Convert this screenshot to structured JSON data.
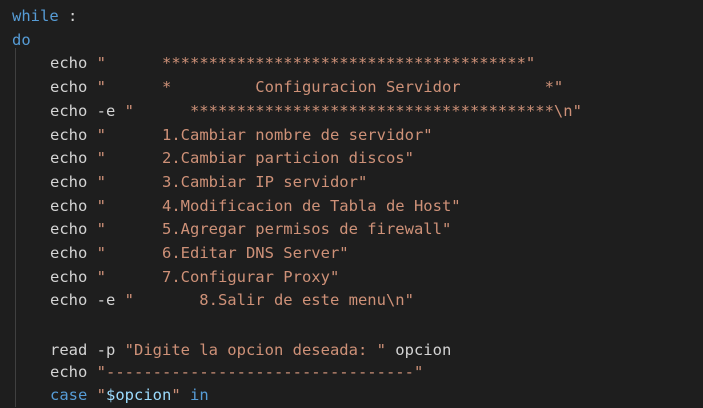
{
  "editor": {
    "lines": [
      {
        "kw": "while",
        "rest": " :"
      },
      {
        "kw": "do"
      },
      {
        "cmd": "echo",
        "str": "\"      ***************************************\""
      },
      {
        "cmd": "echo",
        "str": "\"      *         Configuracion Servidor         *\""
      },
      {
        "cmd": "echo",
        "flag": " -e ",
        "str": "\"      ***************************************\\n\""
      },
      {
        "cmd": "echo",
        "str": "\"      1.Cambiar nombre de servidor\""
      },
      {
        "cmd": "echo",
        "str": "\"      2.Cambiar particion discos\""
      },
      {
        "cmd": "echo",
        "str": "\"      3.Cambiar IP servidor\""
      },
      {
        "cmd": "echo",
        "str": "\"      4.Modificacion de Tabla de Host\""
      },
      {
        "cmd": "echo",
        "str": "\"      5.Agregar permisos de firewall\""
      },
      {
        "cmd": "echo",
        "str": "\"      6.Editar DNS Server\""
      },
      {
        "cmd": "echo",
        "str": "\"      7.Configurar Proxy\""
      },
      {
        "cmd": "echo",
        "flag": " -e ",
        "str": "\"       8.Salir de este menu\\n\""
      },
      {
        "empty": true
      },
      {
        "cmd": "read",
        "flag": " -p ",
        "str": "\"Digite la opcion deseada: \"",
        "rest": " opcion"
      },
      {
        "cmd": "echo",
        "str": "\"---------------------------------\""
      },
      {
        "kw2": "case",
        "space": " ",
        "q1": "\"",
        "var": "$opcion",
        "q2": "\"",
        "tail": " in"
      }
    ]
  },
  "colors": {
    "background": "#1e1e1e",
    "keyword": "#569cd6",
    "string": "#ce9178",
    "variable": "#9cdcfe",
    "text": "#d4d4d4"
  }
}
